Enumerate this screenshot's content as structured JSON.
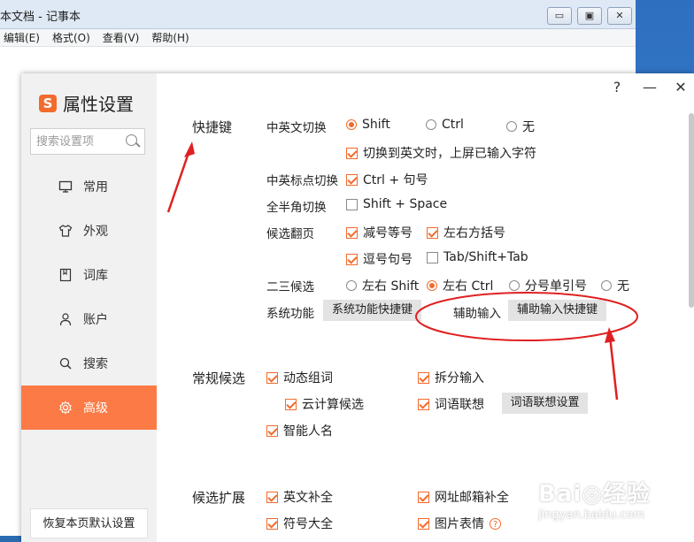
{
  "notepad": {
    "title": "本文档 - 记事本",
    "menu": [
      "编辑(E)",
      "格式(O)",
      "查看(V)",
      "帮助(H)"
    ],
    "buttons": [
      "▭",
      "▣",
      "✕"
    ]
  },
  "dialog": {
    "logo": "S",
    "title": "属性设置",
    "search_placeholder": "搜索设置项",
    "help": "?",
    "minimize": "—",
    "close": "✕",
    "nav": [
      {
        "label": "常用",
        "icon": "monitor-icon"
      },
      {
        "label": "外观",
        "icon": "shirt-icon"
      },
      {
        "label": "词库",
        "icon": "book-icon"
      },
      {
        "label": "账户",
        "icon": "user-icon"
      },
      {
        "label": "搜索",
        "icon": "search-icon"
      },
      {
        "label": "高级",
        "icon": "gear-icon"
      }
    ],
    "restore": "恢复本页默认设置",
    "accent": "#f26b2d"
  },
  "shortcuts": {
    "section": "快捷键",
    "cn_en_switch": {
      "label": "中英文切换",
      "options": [
        "Shift",
        "Ctrl",
        "无"
      ],
      "selected": "Shift"
    },
    "commit_chars": "切换到英文时，上屏已输入字符",
    "punct_switch": {
      "label": "中英标点切换",
      "value": "Ctrl + 句号"
    },
    "fullhalf": {
      "label": "全半角切换",
      "value": "Shift + Space"
    },
    "page_turn": {
      "label": "候选翻页",
      "options": [
        "减号等号",
        "左右方括号",
        "逗号句号",
        "Tab/Shift+Tab"
      ]
    },
    "second_third": {
      "label": "二三候选",
      "options": [
        "左右 Shift",
        "左右 Ctrl",
        "分号单引号",
        "无"
      ],
      "selected": "左右 Ctrl"
    },
    "system": {
      "label": "系统功能",
      "button": "系统功能快捷键"
    },
    "assist": {
      "label": "辅助输入",
      "button": "辅助输入快捷键"
    }
  },
  "candidates": {
    "section": "常规候选",
    "dynamic": "动态组词",
    "split": "拆分输入",
    "cloud": "云计算候选",
    "assoc": "词语联想",
    "assoc_btn": "词语联想设置",
    "smart_name": "智能人名"
  },
  "extension": {
    "section": "候选扩展",
    "en_complete": "英文补全",
    "url_mail": "网址邮箱补全",
    "symbols": "符号大全",
    "emoji": "图片表情",
    "help_icon": "?"
  },
  "watermark": {
    "brand": "Bai◎经验",
    "url": "jingyan.baidu.com"
  }
}
